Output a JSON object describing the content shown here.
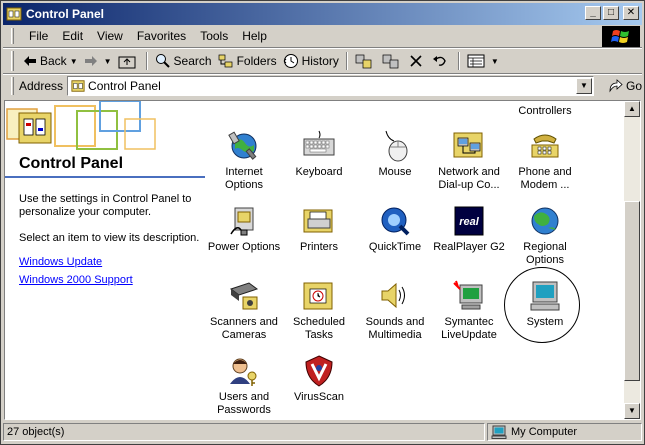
{
  "window": {
    "title": "Control Panel",
    "buttons": {
      "minimize": "_",
      "maximize": "□",
      "close": "✕"
    }
  },
  "menu": [
    "File",
    "Edit",
    "View",
    "Favorites",
    "Tools",
    "Help"
  ],
  "toolbar": {
    "back_label": "Back",
    "search_label": "Search",
    "folders_label": "Folders",
    "history_label": "History"
  },
  "address": {
    "label": "Address",
    "value": "Control Panel",
    "go_label": "Go"
  },
  "left_pane": {
    "title": "Control Panel",
    "description": "Use the settings in Control Panel to personalize your computer.",
    "hint": "Select an item to view its description.",
    "links": [
      "Windows Update",
      "Windows 2000 Support"
    ]
  },
  "items": [
    {
      "label": "Controllers",
      "icon": "controllers-icon"
    },
    {
      "label": "Internet Options",
      "icon": "internet-options-icon"
    },
    {
      "label": "Keyboard",
      "icon": "keyboard-icon"
    },
    {
      "label": "Mouse",
      "icon": "mouse-icon"
    },
    {
      "label": "Network and Dial-up Co...",
      "icon": "network-icon"
    },
    {
      "label": "Phone and Modem ...",
      "icon": "phone-modem-icon"
    },
    {
      "label": "Power Options",
      "icon": "power-options-icon"
    },
    {
      "label": "Printers",
      "icon": "printers-icon"
    },
    {
      "label": "QuickTime",
      "icon": "quicktime-icon"
    },
    {
      "label": "RealPlayer G2",
      "icon": "realplayer-icon"
    },
    {
      "label": "Regional Options",
      "icon": "regional-options-icon"
    },
    {
      "label": "Scanners and Cameras",
      "icon": "scanners-icon"
    },
    {
      "label": "Scheduled Tasks",
      "icon": "scheduled-tasks-icon"
    },
    {
      "label": "Sounds and Multimedia",
      "icon": "sounds-icon"
    },
    {
      "label": "Symantec LiveUpdate",
      "icon": "liveupdate-icon"
    },
    {
      "label": "System",
      "icon": "system-icon"
    },
    {
      "label": "Users and Passwords",
      "icon": "users-icon"
    },
    {
      "label": "VirusScan",
      "icon": "virusscan-icon"
    }
  ],
  "status": {
    "count": "27 object(s)",
    "zone": "My Computer"
  }
}
